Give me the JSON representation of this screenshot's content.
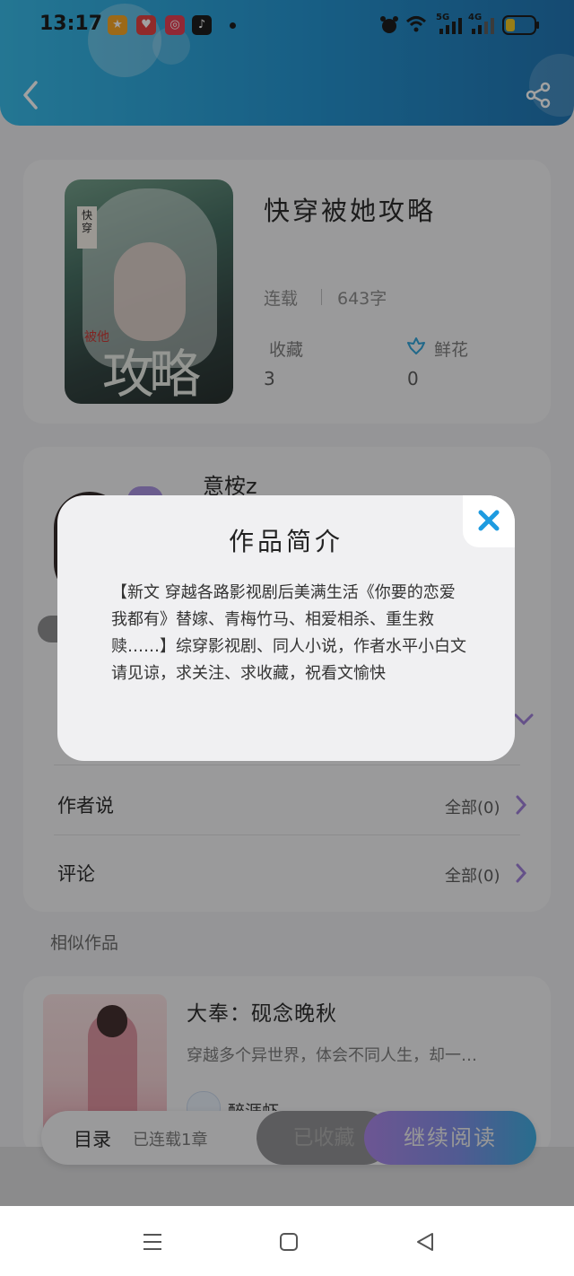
{
  "status_bar": {
    "time": "13:17",
    "network_1": "5G",
    "network_2": "4G"
  },
  "book": {
    "title": "快穿被她攻略",
    "status": "连载",
    "word_count": "643字",
    "favorites_label": "收藏",
    "favorites_value": "3",
    "flowers_label": "鲜花",
    "flowers_value": "0",
    "cover_tag": "快穿",
    "cover_sub": "被他",
    "cover_title": "攻略"
  },
  "author": {
    "name": "意桉z"
  },
  "rows": [
    {
      "title": "作者说",
      "right": "全部(0)"
    },
    {
      "title": "评论",
      "right": "全部(0)"
    }
  ],
  "similar": {
    "section_title": "相似作品",
    "title": "大奉：砚念晚秋",
    "desc": "穿越多个异世界，体会不同人生，却一…",
    "author": "醉涯虾"
  },
  "bottom_bar": {
    "toc_label": "目录",
    "toc_sub": "已连载1章",
    "collect_label": "已收藏",
    "read_label": "继续阅读"
  },
  "modal": {
    "title": "作品简介",
    "body": "【新文 穿越各路影视剧后美满生活《你要的恋爱我都有》替嫁、青梅竹马、相爱相杀、重生救赎……】综穿影视剧、同人小说，作者水平小白文请见谅，求关注、求收藏，祝看文愉快"
  },
  "colors": {
    "header_start": "#2fb8e8",
    "header_end": "#166fb0",
    "accent_purple": "#a882e8",
    "close_blue": "#1e9be0"
  },
  "icons": [
    "back-icon",
    "share-icon",
    "flower-icon",
    "close-icon",
    "chevron-right-icon",
    "chevron-down-icon",
    "menu-icon",
    "home-icon",
    "back-triangle-icon"
  ]
}
